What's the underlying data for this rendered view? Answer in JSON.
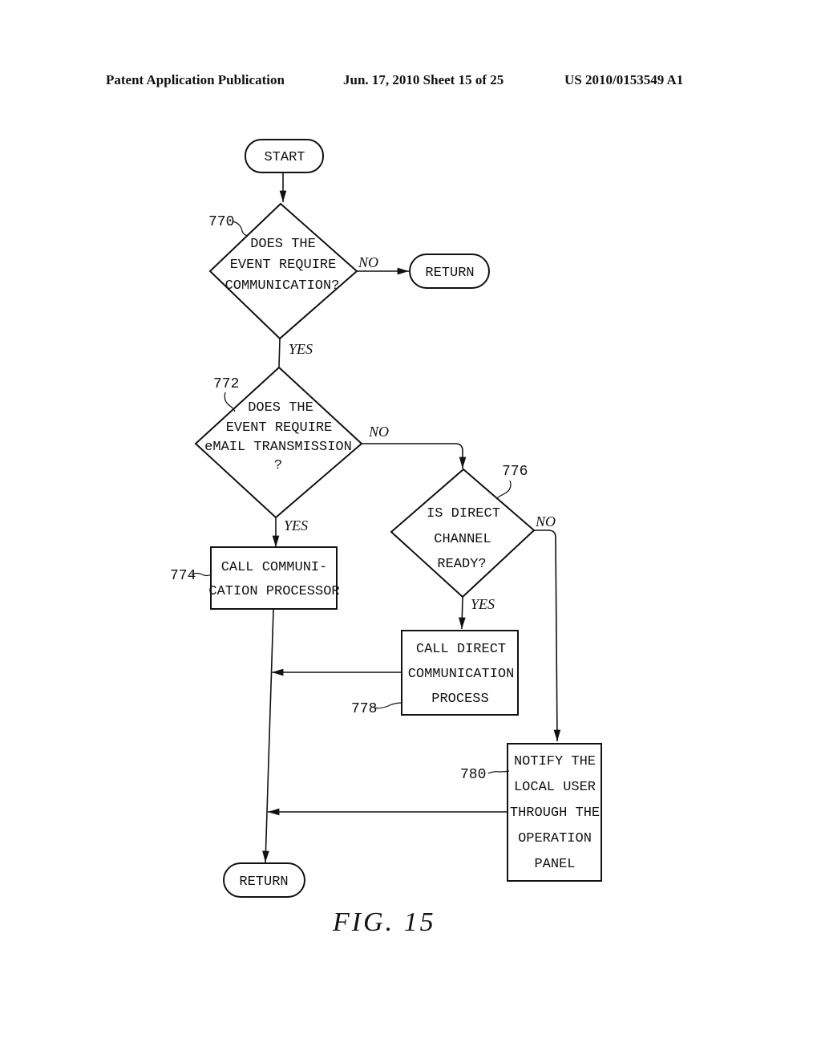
{
  "header": {
    "publication": "Patent Application Publication",
    "date_sheet": "Jun. 17, 2010  Sheet 15 of 25",
    "number": "US 2010/0153549 A1"
  },
  "figure": {
    "caption": "FIG. 15",
    "nodes": {
      "start": {
        "type": "terminal",
        "lines": [
          "START"
        ]
      },
      "d770": {
        "type": "decision",
        "ref": "770",
        "lines": [
          "DOES THE",
          "EVENT REQUIRE",
          "COMMUNICATION?"
        ]
      },
      "return1": {
        "type": "terminal",
        "lines": [
          "RETURN"
        ]
      },
      "d772": {
        "type": "decision",
        "ref": "772",
        "lines": [
          "DOES THE",
          "EVENT REQUIRE",
          "eMAIL TRANSMISSION",
          "?"
        ]
      },
      "p774": {
        "type": "process",
        "ref": "774",
        "lines": [
          "CALL COMMUNI-",
          "CATION PROCESSOR"
        ]
      },
      "d776": {
        "type": "decision",
        "ref": "776",
        "lines": [
          "IS DIRECT",
          "CHANNEL",
          "READY?"
        ]
      },
      "p778": {
        "type": "process",
        "ref": "778",
        "lines": [
          "CALL DIRECT",
          "COMMUNICATION",
          "PROCESS"
        ]
      },
      "p780": {
        "type": "process",
        "ref": "780",
        "lines": [
          "NOTIFY THE",
          "LOCAL USER",
          "THROUGH THE",
          "OPERATION",
          "PANEL"
        ]
      },
      "return2": {
        "type": "terminal",
        "lines": [
          "RETURN"
        ]
      }
    },
    "edge_labels": {
      "d770_no": "NO",
      "d770_yes": "YES",
      "d772_no": "NO",
      "d772_yes": "YES",
      "d776_no": "NO",
      "d776_yes": "YES"
    }
  }
}
